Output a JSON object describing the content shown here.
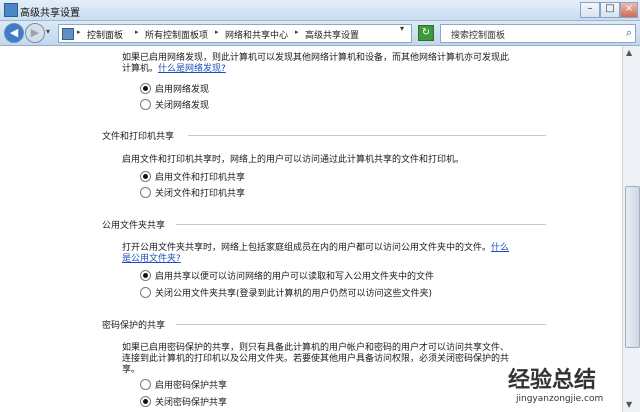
{
  "window": {
    "title": "高级共享设置"
  },
  "nav": {
    "breadcrumbs": [
      "控制面板",
      "所有控制面板项",
      "网络和共享中心",
      "高级共享设置"
    ],
    "search_placeholder": "搜索控制面板"
  },
  "network_discovery": {
    "desc_line1": "如果已启用网络发现，则此计算机可以发现其他网络计算机和设备，而其他网络计算机亦可发现此",
    "desc_line2_prefix": "计算机。",
    "help_link": "什么是网络发现?",
    "options": [
      {
        "label": "启用网络发现",
        "selected": true
      },
      {
        "label": "关闭网络发现",
        "selected": false
      }
    ]
  },
  "file_printer": {
    "title": "文件和打印机共享",
    "desc": "启用文件和打印机共享时，网络上的用户可以访问通过此计算机共享的文件和打印机。",
    "options": [
      {
        "label": "启用文件和打印机共享",
        "selected": true
      },
      {
        "label": "关闭文件和打印机共享",
        "selected": false
      }
    ]
  },
  "public_folder": {
    "title": "公用文件夹共享",
    "desc_line1": "打开公用文件夹共享时，网络上包括家庭组成员在内的用户都可以访问公用文件夹中的文件。",
    "help_link_part1": "什么",
    "help_link_part2": "是公用文件夹?",
    "options": [
      {
        "label": "启用共享以便可以访问网络的用户可以读取和写入公用文件夹中的文件",
        "selected": true
      },
      {
        "label": "关闭公用文件夹共享(登录到此计算机的用户仍然可以访问这些文件夹)",
        "selected": false
      }
    ]
  },
  "password": {
    "title": "密码保护的共享",
    "desc_line1": "如果已启用密码保护的共享，则只有具备此计算机的用户帐户和密码的用户才可以访问共享文件、",
    "desc_line2": "连接到此计算机的打印机以及公用文件夹。若要使其他用户具备访问权限，必须关闭密码保护的共",
    "desc_line3": "享。",
    "options": [
      {
        "label": "启用密码保护共享",
        "selected": false
      },
      {
        "label": "关闭密码保护共享",
        "selected": true
      }
    ]
  },
  "watermark": {
    "main": "经验总结",
    "sub": "jingyanzongjie.com"
  }
}
